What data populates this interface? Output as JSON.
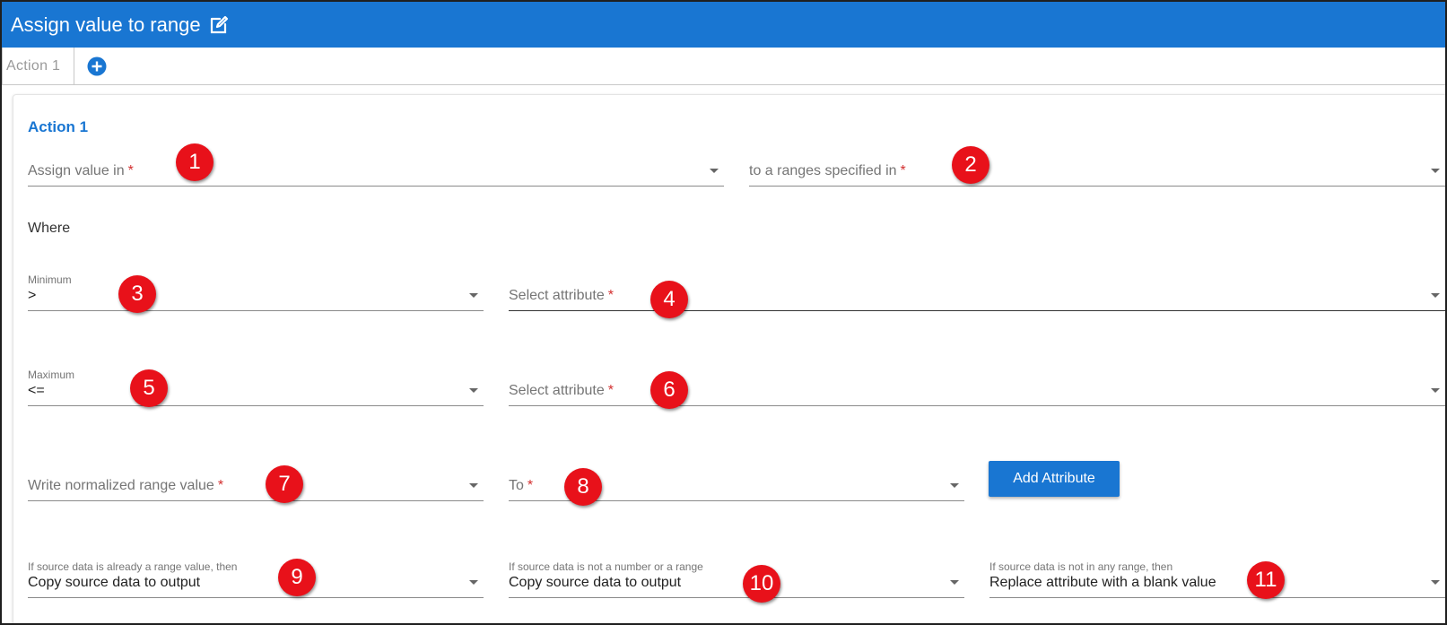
{
  "header": {
    "title": "Assign value to range",
    "edit_icon": "edit-icon"
  },
  "tabs": [
    {
      "label": "Action 1"
    }
  ],
  "add_tab_icon": "plus-circle-icon",
  "section": {
    "title": "Action 1"
  },
  "fields": {
    "assign_value_in": {
      "placeholder": "Assign value in",
      "required": "*"
    },
    "ranges_specified_in": {
      "placeholder": "to a ranges specified in",
      "required": "*"
    },
    "where_label": "Where",
    "minimum": {
      "caption": "Minimum",
      "value": ">"
    },
    "min_attribute": {
      "placeholder": "Select attribute",
      "required": "*"
    },
    "maximum": {
      "caption": "Maximum",
      "value": "<="
    },
    "max_attribute": {
      "placeholder": "Select attribute",
      "required": "*"
    },
    "normalized_value": {
      "placeholder": "Write normalized range value",
      "required": "*"
    },
    "to": {
      "placeholder": "To",
      "required": "*"
    },
    "already_range": {
      "caption": "If source data is already a range value, then",
      "value": "Copy source data to output"
    },
    "not_number": {
      "caption": "If source data is not a number or a range",
      "value": "Copy source data to output"
    },
    "not_in_range": {
      "caption": "If source data is not in any range, then",
      "value": "Replace attribute with a blank value"
    }
  },
  "buttons": {
    "add_attribute": "Add Attribute"
  },
  "annotations": [
    "1",
    "2",
    "3",
    "4",
    "5",
    "6",
    "7",
    "8",
    "9",
    "10",
    "11"
  ],
  "colors": {
    "primary": "#1976d2",
    "required": "#d32f2f",
    "annotation": "#e8111a"
  }
}
